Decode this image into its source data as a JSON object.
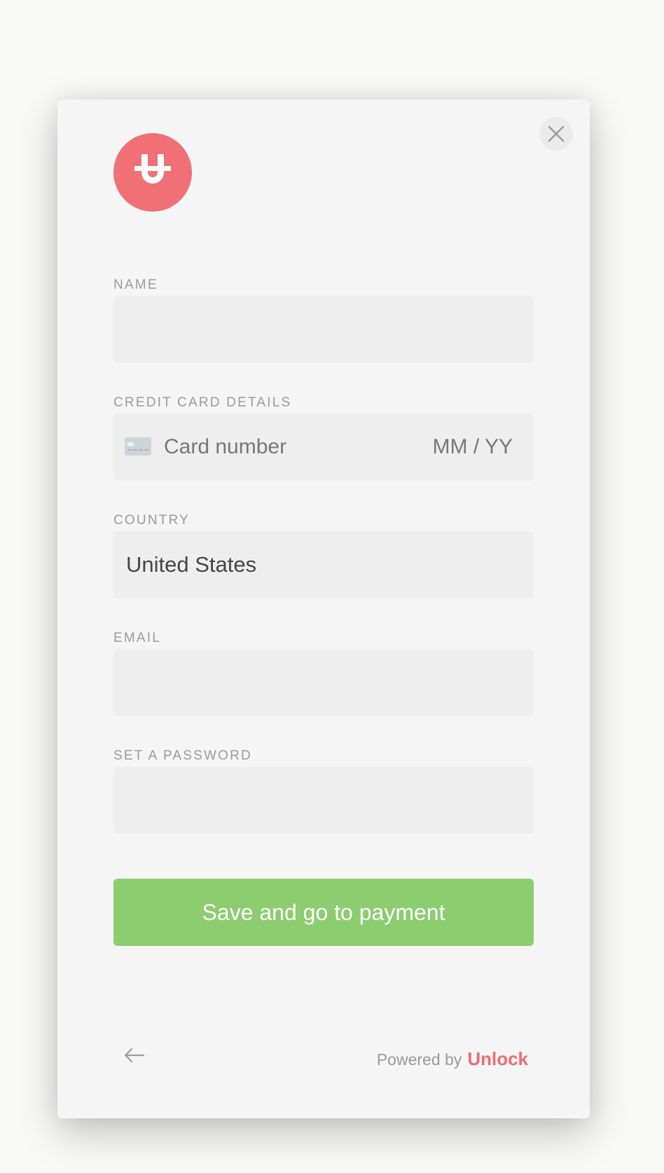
{
  "form": {
    "name_label": "NAME",
    "name_value": "",
    "card_label": "CREDIT CARD DETAILS",
    "card_number_placeholder": "Card number",
    "card_expiry_placeholder": "MM / YY",
    "country_label": "COUNTRY",
    "country_value": "United States",
    "email_label": "EMAIL",
    "email_value": "",
    "password_label": "SET A PASSWORD",
    "password_value": ""
  },
  "actions": {
    "submit_label": "Save and go to payment"
  },
  "footer": {
    "powered_by": "Powered by",
    "brand": "Unlock"
  },
  "icons": {
    "close": "close-icon",
    "logo": "unlock-logo-icon",
    "card": "credit-card-icon",
    "back": "arrow-left-icon"
  },
  "colors": {
    "brand": "#f07075",
    "button": "#8bcd6f",
    "label": "#9a9a9a",
    "field_bg": "#eeeeef"
  }
}
